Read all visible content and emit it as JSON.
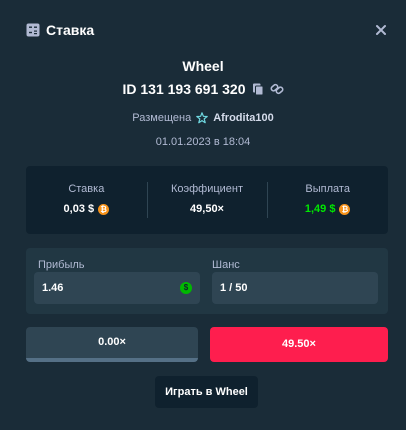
{
  "header": {
    "title": "Ставка",
    "icon": "bet-slip-icon",
    "close_icon": "close-icon"
  },
  "game": {
    "name": "Wheel"
  },
  "bet": {
    "id": "ID 131 193 691 320",
    "copy_icon": "copy-icon",
    "link_icon": "link-icon",
    "placed_label": "Размещена",
    "user_icon": "vip-star-icon",
    "username": "Afrodita100",
    "date": "01.01.2023 в 18:04"
  },
  "stats": [
    {
      "label": "Ставка",
      "value": "0,03 $",
      "coin": "bitcoin-icon"
    },
    {
      "label": "Коэффициент",
      "value": "49,50×"
    },
    {
      "label": "Выплата",
      "value": "1,49 $",
      "coin": "bitcoin-icon",
      "color": "#00e701"
    }
  ],
  "calc": {
    "profit_label": "Прибыль",
    "profit_value": "1.46",
    "profit_icon": "dollar-icon",
    "chance_label": "Шанс",
    "chance_value": "1 / 50"
  },
  "segments": {
    "lose_label": "0.00×",
    "win_label": "49.50×",
    "lose_color": "#2f4553",
    "win_color": "#fe1e4e"
  },
  "play_button": "Играть в Wheel",
  "colors": {
    "background": "#1a2c38",
    "panel": "#0f212e",
    "card": "#213743",
    "accent_green": "#00e701"
  }
}
